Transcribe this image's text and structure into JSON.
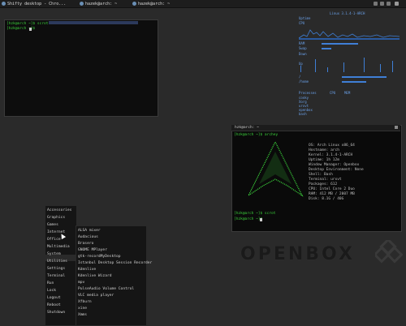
{
  "taskbar": {
    "tasks": [
      "Shifty desktop - Chro...",
      "hazek@arch: ~",
      "hazek@arch: ~"
    ]
  },
  "terminal_left": {
    "line1": "[hzk@arch ~]$ scrot",
    "line2": "[hzk@arch ~]$ "
  },
  "conky": {
    "header": "Linux 3.1.4-1-ARCH",
    "uptime": "Uptime",
    "cpu": "CPU",
    "ram": "RAM",
    "swap": "Swap",
    "net_down": "Down",
    "net_up": "Up",
    "processes": "Processes",
    "fs_root": "/",
    "fs_home": "/home",
    "proc_rows": [
      "conky",
      "Xorg",
      "urxvt",
      "openbox",
      "bash"
    ],
    "proc_cols": [
      "CPU",
      "MEM"
    ]
  },
  "terminal_right": {
    "title": "hzk@arch: ~",
    "prompt1": "[hzk@arch ~]$ archey",
    "info": [
      "OS: Arch Linux x86_64",
      "Hostname: arch",
      "Kernel: 3.1.4-1-ARCH",
      "Uptime: 1h 12m",
      "Window Manager: Openbox",
      "Desktop Environment: None",
      "Shell: Bash",
      "Terminal: urxvt",
      "Packages: 612",
      "CPU: Intel Core 2 Duo",
      "RAM: 412 MB / 2007 MB",
      "Disk: 8.1G / 40G"
    ],
    "prompt2": "[hzk@arch ~]$ scrot",
    "prompt3": "[hzk@arch ~]$ "
  },
  "logo": "OPENBOX",
  "menu_main": [
    "Accessories",
    "Graphics",
    "Games",
    "Internet",
    "Office",
    "Multimedia",
    "System",
    "Utilities",
    "Settings",
    "Terminal",
    "Run",
    "Lock",
    "Logout",
    "Reboot",
    "Shutdown"
  ],
  "menu_multimedia": [
    "ALSA mixer",
    "Audacious",
    "Brasero",
    "GNOME MPlayer",
    "gtk-recordMyDesktop",
    "Istanbul Desktop Session Recorder",
    "Kdenlive",
    "Kdenlive Wizard",
    "mpv",
    "PulseAudio Volume Control",
    "VLC media player",
    "Xfburn",
    "xine",
    "Xmms"
  ]
}
